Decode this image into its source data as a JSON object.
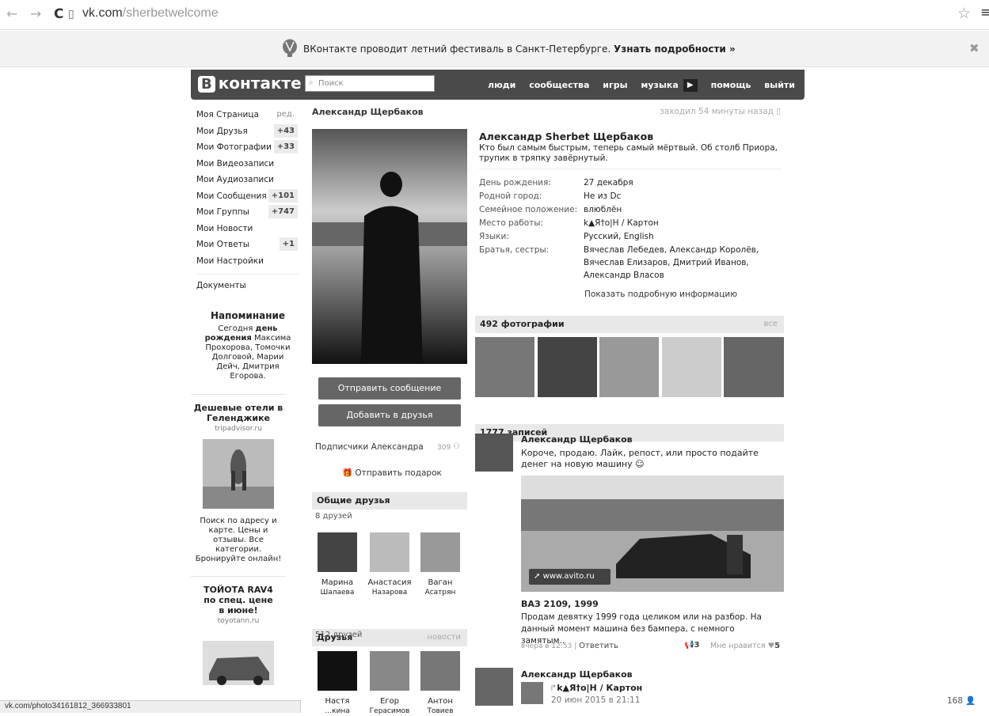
{
  "browser": {
    "url_host": "vk.com",
    "url_path": "/sherbetwelcome",
    "status_url": "vk.com/photo34161812_366933801"
  },
  "banner": {
    "text": "ВКонтакте проводит летний фестиваль в Санкт-Петербурге.",
    "link": "Узнать подробности »"
  },
  "header": {
    "logo_b": "В",
    "logo_text": "контакте",
    "search_placeholder": "Поиск",
    "nav": [
      "люди",
      "сообщества",
      "игры",
      "музыка",
      "помощь",
      "выйти"
    ]
  },
  "menu": {
    "items": [
      {
        "label": "Моя Страница",
        "extra": "ред."
      },
      {
        "label": "Мои Друзья",
        "count": "+43"
      },
      {
        "label": "Мои Фотографии",
        "count": "+33"
      },
      {
        "label": "Мои Видеозаписи"
      },
      {
        "label": "Мои Аудиозаписи"
      },
      {
        "label": "Мои Сообщения",
        "count": "+101"
      },
      {
        "label": "Мои Группы",
        "count": "+747"
      },
      {
        "label": "Мои Новости"
      },
      {
        "label": "Мои Ответы",
        "count": "+1"
      },
      {
        "label": "Мои Настройки"
      }
    ],
    "documents": "Документы"
  },
  "reminder": {
    "title": "Напоминание",
    "text_pre": "Сегодня ",
    "text_bold": "день рождения",
    "text_post": " Максима Прохорова, Томочки Долговой, Марии Дейч, Дмитрия Егорова."
  },
  "ads": [
    {
      "title": "Дешевые отели в Геленджике",
      "host": "tripadvisor.ru",
      "text": "Поиск по адресу и карте. Цены и отзывы. Все категории. Бронируйте онлайн!"
    },
    {
      "title": "ТОЙОТА RAV4 по спец. цене в июне!",
      "host": "toyotann.ru"
    }
  ],
  "profile": {
    "short_name": "Александр Щербаков",
    "last_seen": "заходил 54 минуты назад",
    "full_name": "Александр Sherbet Щербаков",
    "status": "Кто был самым быстрым, теперь самый мёртвый. Об столб Приора, трупик в тряпку завёрнутый.",
    "info": [
      {
        "k": "День рождения:",
        "v": "27 декабря"
      },
      {
        "k": "Родной город:",
        "v": "Не из Dc"
      },
      {
        "k": "Семейное положение:",
        "v": "влюблён"
      },
      {
        "k": "Место работы:",
        "v": "k▲Я†o|H / Картон"
      },
      {
        "k": "Языки:",
        "v": "Русский, English"
      },
      {
        "k": "Братья, сестры:",
        "v": "Вячеслав Лебедев, Александр Королёв, Вячеслав Елизаров, Дмитрий Иванов, Александр Власов"
      }
    ],
    "more_info": "Показать подробную информацию",
    "send_message": "Отправить сообщение",
    "add_friend": "Добавить в друзья",
    "subscribers": "Подписчики Александра",
    "subscribers_count": "309",
    "send_gift": "Отправить подарок"
  },
  "common_friends": {
    "title": "Общие друзья",
    "count": "8 друзей",
    "list": [
      {
        "first": "Марина",
        "last": "Шалаева"
      },
      {
        "first": "Анастасия",
        "last": "Назарова"
      },
      {
        "first": "Ваган",
        "last": "Асатрян"
      }
    ]
  },
  "friends": {
    "title": "Друзья",
    "news": "новости",
    "count": "512 друзей",
    "list": [
      {
        "first": "Настя",
        "last": "…кина"
      },
      {
        "first": "Егор",
        "last": "Герасимов"
      },
      {
        "first": "Антон",
        "last": "Товиев"
      }
    ]
  },
  "photos": {
    "title": "492 фотографии",
    "all": "все"
  },
  "wall": {
    "title": "1777 записей",
    "post1": {
      "author": "Александр Щербаков",
      "text": "Короче, продаю. Лайк, репост, или просто подайте денег на новую машину",
      "link": "www.avito.ru",
      "att_title": "ВАЗ 2109, 1999",
      "att_text": "Продам девятку 1999 года целиком или на разбор. На данный момент машина без бампера, с немного замятым..",
      "time": "вчера в 12:53",
      "reply": "Ответить",
      "reposts": "3",
      "like_label": "Мне нравится",
      "likes": "5"
    },
    "post2": {
      "author": "Александр Щербаков",
      "repost_name": "k▲Я†o|H / Картон",
      "repost_date": "20 июн 2015 в 21:11"
    }
  },
  "online_count": "168"
}
